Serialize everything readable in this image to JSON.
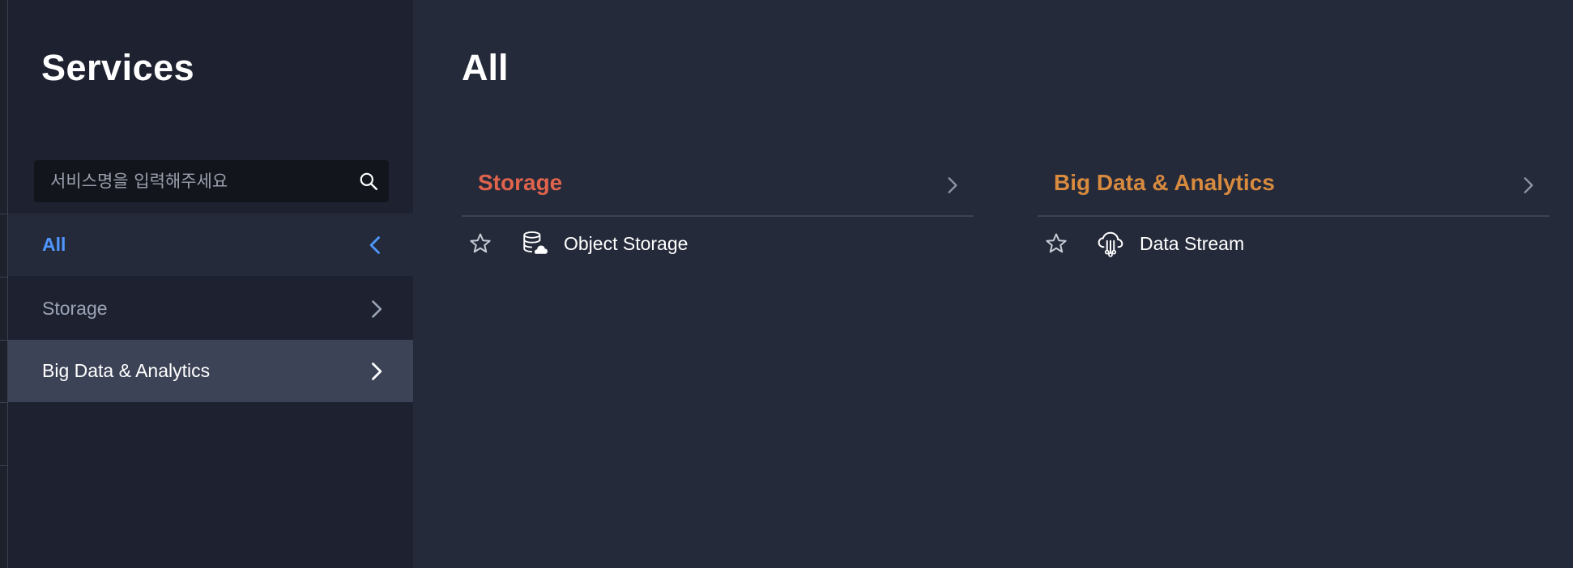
{
  "sidebar": {
    "title": "Services",
    "search": {
      "placeholder": "서비스명을 입력해주세요",
      "value": ""
    },
    "items": [
      {
        "label": "All",
        "state": "active",
        "icon": "chevron-left-icon"
      },
      {
        "label": "Storage",
        "state": "normal",
        "icon": "chevron-right-icon"
      },
      {
        "label": "Big Data & Analytics",
        "state": "hovered",
        "icon": "chevron-right-icon"
      }
    ]
  },
  "main": {
    "title": "All",
    "categories": [
      {
        "name": "Storage",
        "color": "#e0634c",
        "services": [
          {
            "name": "Object Storage",
            "icon": "database-icon",
            "favorited": false
          }
        ]
      },
      {
        "name": "Big Data & Analytics",
        "color": "#d88a3f",
        "services": [
          {
            "name": "Data Stream",
            "icon": "cloud-stream-icon",
            "favorited": false
          }
        ]
      }
    ]
  },
  "colors": {
    "background": "#252a3a",
    "sidebar": "#1e2230",
    "active_accent": "#4f97ff",
    "hover_row": "#3d4357"
  }
}
